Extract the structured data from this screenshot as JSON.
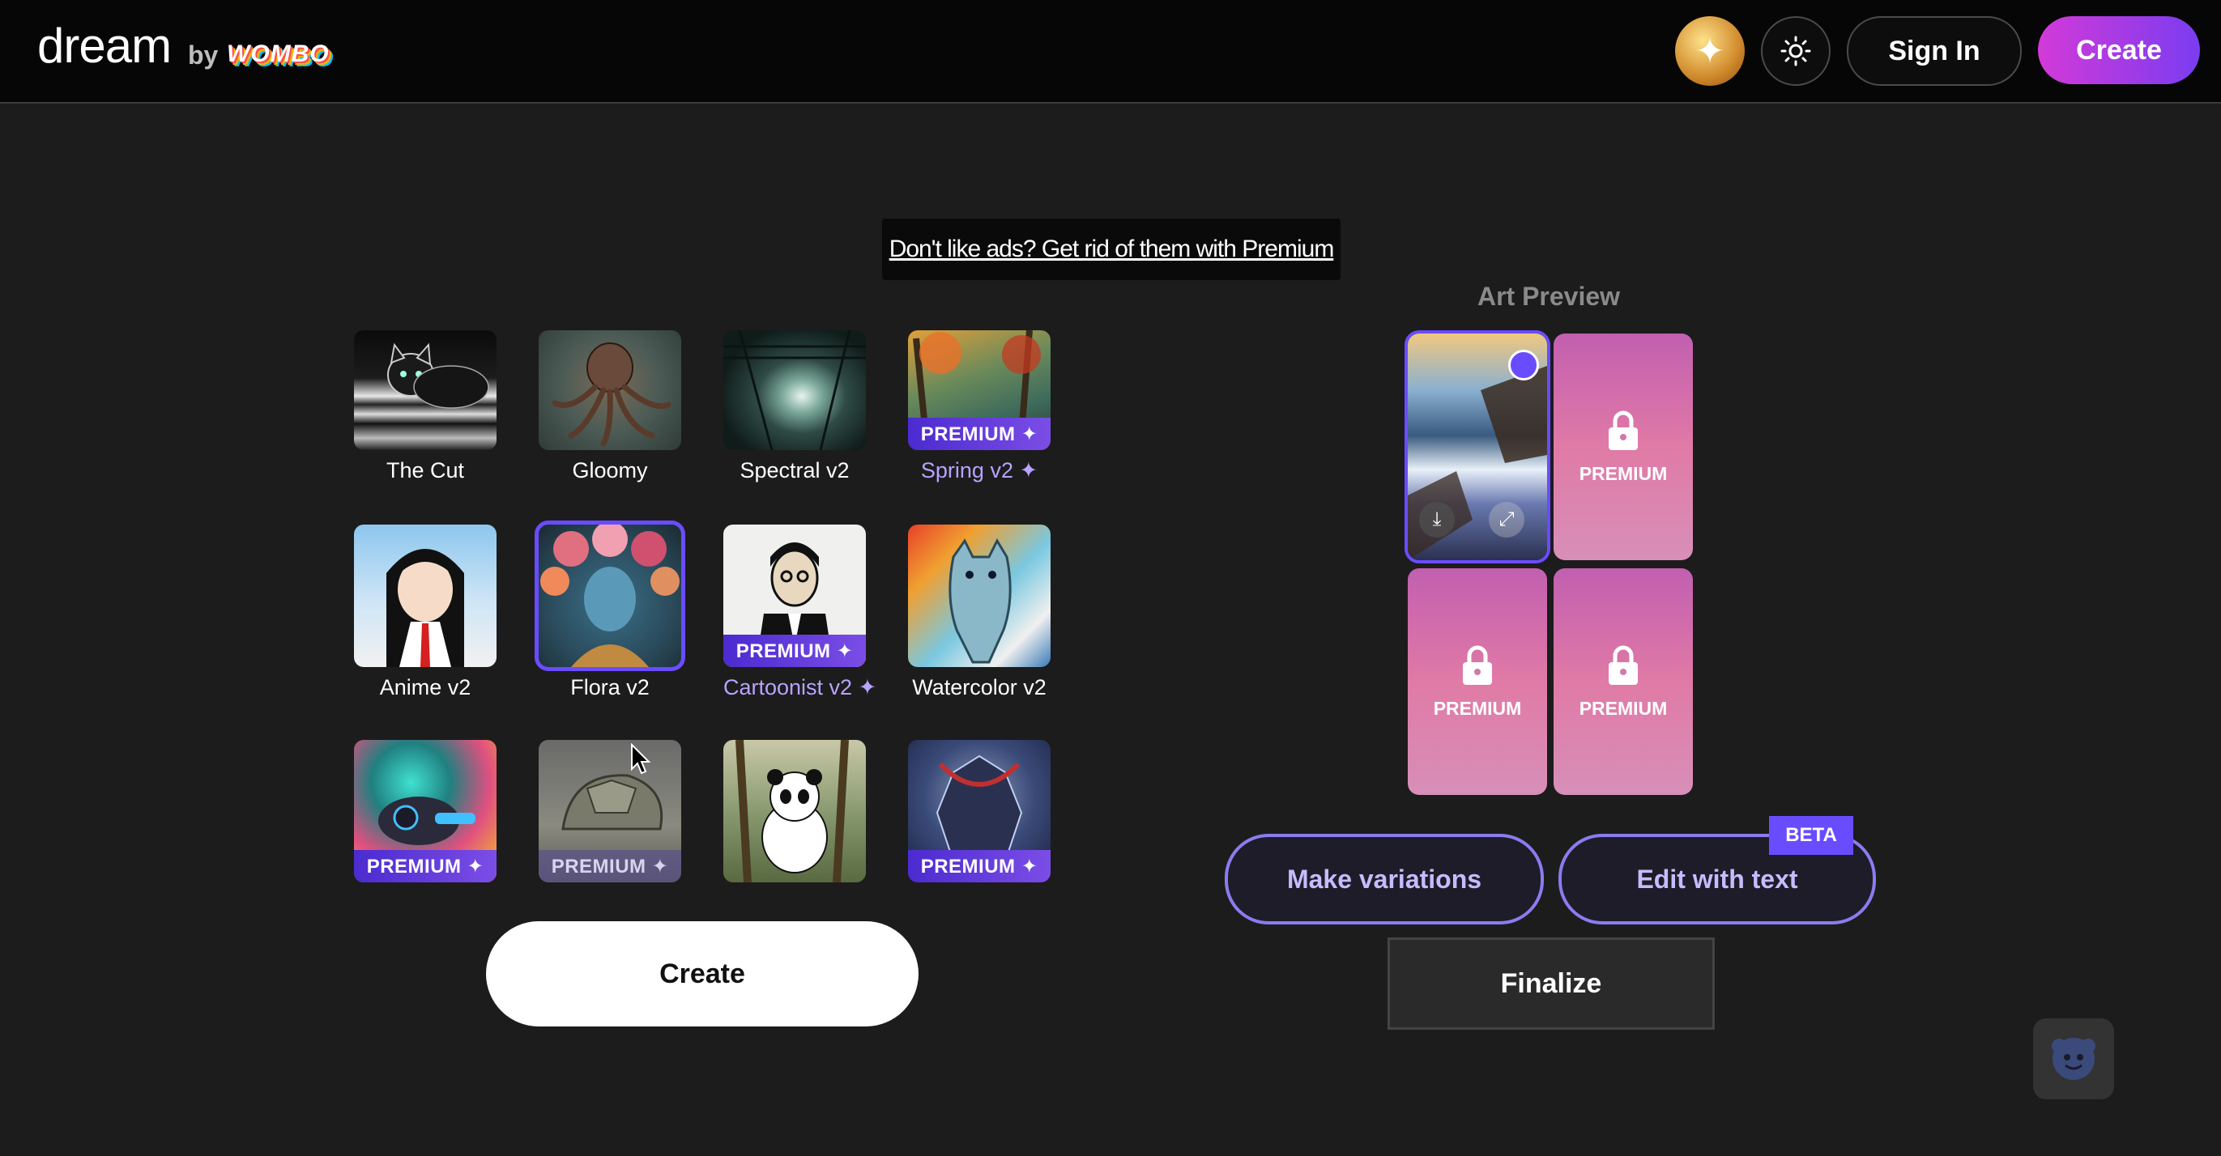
{
  "header": {
    "logo_text": "dream",
    "by_text": "by",
    "brand_text": "WOMBO",
    "signin_label": "Sign In",
    "create_label": "Create"
  },
  "ad_banner": {
    "text": "Don't like ads? Get rid of them with Premium"
  },
  "styles": [
    {
      "name": "The Cut",
      "premium": false,
      "selected": false
    },
    {
      "name": "Gloomy",
      "premium": false,
      "selected": false
    },
    {
      "name": "Spectral v2",
      "premium": false,
      "selected": false
    },
    {
      "name": "Spring v2 ✦",
      "premium": true,
      "ribbon": "PREMIUM ✦",
      "selected": false
    },
    {
      "name": "Anime v2",
      "premium": false,
      "selected": false
    },
    {
      "name": "Flora v2",
      "premium": false,
      "selected": true
    },
    {
      "name": "Cartoonist v2 ✦",
      "premium": true,
      "ribbon": "PREMIUM ✦",
      "selected": false
    },
    {
      "name": "Watercolor v2",
      "premium": false,
      "selected": false
    },
    {
      "name": "",
      "premium": true,
      "ribbon": "PREMIUM ✦",
      "selected": false
    },
    {
      "name": "",
      "premium": true,
      "ribbon": "PREMIUM ✦",
      "selected": false
    },
    {
      "name": "",
      "premium": false,
      "selected": false
    },
    {
      "name": "",
      "premium": true,
      "ribbon": "PREMIUM ✦",
      "selected": false
    }
  ],
  "create_button_label": "Create",
  "art_preview": {
    "title": "Art Preview",
    "locked_label": "PREMIUM"
  },
  "actions": {
    "make_variations": "Make variations",
    "edit_with_text": "Edit with text",
    "beta_badge": "BETA",
    "finalize": "Finalize"
  },
  "colors": {
    "accent": "#6a4cff",
    "premium_text": "#b8a3ff",
    "background": "#1c1c1c"
  }
}
